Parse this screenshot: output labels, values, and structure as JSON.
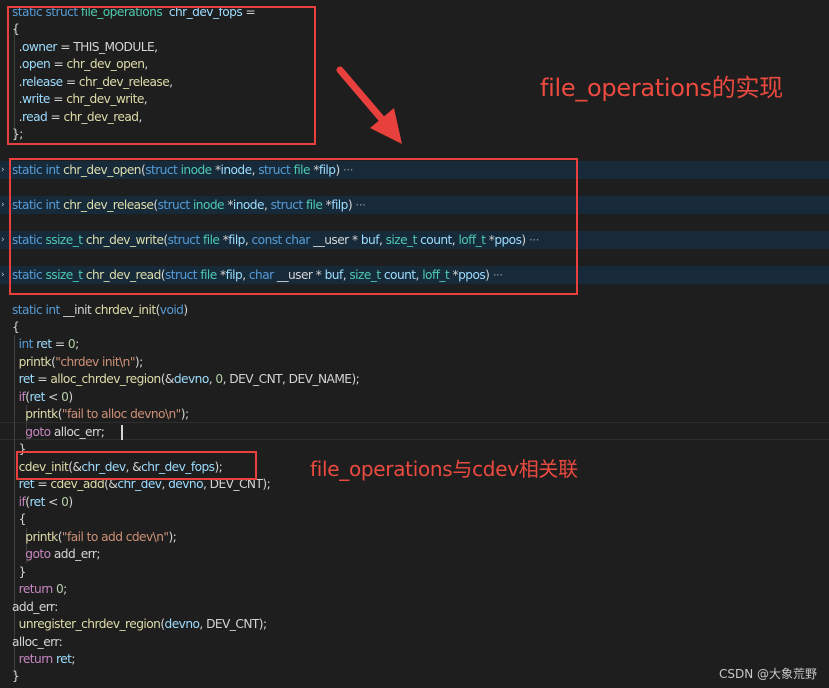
{
  "code": {
    "l01": [
      {
        "t": "static",
        "c": "kw"
      },
      {
        "t": " "
      },
      {
        "t": "struct",
        "c": "kw"
      },
      {
        "t": " "
      },
      {
        "t": "file_operations",
        "c": "ty"
      },
      {
        "t": "  "
      },
      {
        "t": "chr_dev_fops",
        "c": "var"
      },
      {
        "t": " ="
      }
    ],
    "l02": [
      {
        "t": "{"
      }
    ],
    "l03": [
      {
        "t": "  ."
      },
      {
        "t": "owner",
        "c": "var"
      },
      {
        "t": " = THIS_MODULE,"
      }
    ],
    "l04": [
      {
        "t": "  ."
      },
      {
        "t": "open",
        "c": "var"
      },
      {
        "t": " = "
      },
      {
        "t": "chr_dev_open",
        "c": "fn"
      },
      {
        "t": ","
      }
    ],
    "l05": [
      {
        "t": "  ."
      },
      {
        "t": "release",
        "c": "var"
      },
      {
        "t": " = "
      },
      {
        "t": "chr_dev_release",
        "c": "fn"
      },
      {
        "t": ","
      }
    ],
    "l06": [
      {
        "t": "  ."
      },
      {
        "t": "write",
        "c": "var"
      },
      {
        "t": " = "
      },
      {
        "t": "chr_dev_write",
        "c": "fn"
      },
      {
        "t": ","
      }
    ],
    "l07": [
      {
        "t": "  ."
      },
      {
        "t": "read",
        "c": "var"
      },
      {
        "t": " = "
      },
      {
        "t": "chr_dev_read",
        "c": "fn"
      },
      {
        "t": ","
      }
    ],
    "l08": [
      {
        "t": "};"
      }
    ],
    "l09": [
      {
        "t": "static",
        "c": "kw"
      },
      {
        "t": " "
      },
      {
        "t": "int",
        "c": "kw"
      },
      {
        "t": " "
      },
      {
        "t": "chr_dev_open",
        "c": "fn"
      },
      {
        "t": "("
      },
      {
        "t": "struct",
        "c": "kw"
      },
      {
        "t": " "
      },
      {
        "t": "inode",
        "c": "ty"
      },
      {
        "t": " *"
      },
      {
        "t": "inode",
        "c": "var"
      },
      {
        "t": ", "
      },
      {
        "t": "struct",
        "c": "kw"
      },
      {
        "t": " "
      },
      {
        "t": "file",
        "c": "ty"
      },
      {
        "t": " *"
      },
      {
        "t": "filp",
        "c": "var"
      },
      {
        "t": ")"
      },
      {
        "t": " ···",
        "c": "ell"
      }
    ],
    "l10": [
      {
        "t": "static",
        "c": "kw"
      },
      {
        "t": " "
      },
      {
        "t": "int",
        "c": "kw"
      },
      {
        "t": " "
      },
      {
        "t": "chr_dev_release",
        "c": "fn"
      },
      {
        "t": "("
      },
      {
        "t": "struct",
        "c": "kw"
      },
      {
        "t": " "
      },
      {
        "t": "inode",
        "c": "ty"
      },
      {
        "t": " *"
      },
      {
        "t": "inode",
        "c": "var"
      },
      {
        "t": ", "
      },
      {
        "t": "struct",
        "c": "kw"
      },
      {
        "t": " "
      },
      {
        "t": "file",
        "c": "ty"
      },
      {
        "t": " *"
      },
      {
        "t": "filp",
        "c": "var"
      },
      {
        "t": ")"
      },
      {
        "t": " ···",
        "c": "ell"
      }
    ],
    "l11": [
      {
        "t": "static",
        "c": "kw"
      },
      {
        "t": " "
      },
      {
        "t": "ssize_t",
        "c": "ty"
      },
      {
        "t": " "
      },
      {
        "t": "chr_dev_write",
        "c": "fn"
      },
      {
        "t": "("
      },
      {
        "t": "struct",
        "c": "kw"
      },
      {
        "t": " "
      },
      {
        "t": "file",
        "c": "ty"
      },
      {
        "t": " *"
      },
      {
        "t": "filp",
        "c": "var"
      },
      {
        "t": ", "
      },
      {
        "t": "const",
        "c": "kw"
      },
      {
        "t": " "
      },
      {
        "t": "char",
        "c": "kw"
      },
      {
        "t": " __user * "
      },
      {
        "t": "buf",
        "c": "var"
      },
      {
        "t": ", "
      },
      {
        "t": "size_t",
        "c": "ty"
      },
      {
        "t": " "
      },
      {
        "t": "count",
        "c": "var"
      },
      {
        "t": ", "
      },
      {
        "t": "loff_t",
        "c": "ty"
      },
      {
        "t": " *"
      },
      {
        "t": "ppos",
        "c": "var"
      },
      {
        "t": ")"
      },
      {
        "t": " ···",
        "c": "ell"
      }
    ],
    "l12": [
      {
        "t": "static",
        "c": "kw"
      },
      {
        "t": " "
      },
      {
        "t": "ssize_t",
        "c": "ty"
      },
      {
        "t": " "
      },
      {
        "t": "chr_dev_read",
        "c": "fn"
      },
      {
        "t": "("
      },
      {
        "t": "struct",
        "c": "kw"
      },
      {
        "t": " "
      },
      {
        "t": "file",
        "c": "ty"
      },
      {
        "t": " *"
      },
      {
        "t": "filp",
        "c": "var"
      },
      {
        "t": ", "
      },
      {
        "t": "char",
        "c": "kw"
      },
      {
        "t": " __user * "
      },
      {
        "t": "buf",
        "c": "var"
      },
      {
        "t": ", "
      },
      {
        "t": "size_t",
        "c": "ty"
      },
      {
        "t": " "
      },
      {
        "t": "count",
        "c": "var"
      },
      {
        "t": ", "
      },
      {
        "t": "loff_t",
        "c": "ty"
      },
      {
        "t": " *"
      },
      {
        "t": "ppos",
        "c": "var"
      },
      {
        "t": ")"
      },
      {
        "t": " ···",
        "c": "ell"
      }
    ],
    "l13": [
      {
        "t": "static",
        "c": "kw"
      },
      {
        "t": " "
      },
      {
        "t": "int",
        "c": "kw"
      },
      {
        "t": " __init "
      },
      {
        "t": "chrdev_init",
        "c": "fn"
      },
      {
        "t": "("
      },
      {
        "t": "void",
        "c": "kw"
      },
      {
        "t": ")"
      }
    ],
    "l14": [
      {
        "t": "{"
      }
    ],
    "l15": [
      {
        "t": "  "
      },
      {
        "t": "int",
        "c": "kw"
      },
      {
        "t": " "
      },
      {
        "t": "ret",
        "c": "var"
      },
      {
        "t": " = "
      },
      {
        "t": "0",
        "c": "num"
      },
      {
        "t": ";"
      }
    ],
    "l16": [
      {
        "t": "  "
      },
      {
        "t": "printk",
        "c": "fn"
      },
      {
        "t": "("
      },
      {
        "t": "\"chrdev init\\n\"",
        "c": "str"
      },
      {
        "t": ");"
      }
    ],
    "l17": [
      {
        "t": "  "
      },
      {
        "t": "ret",
        "c": "var"
      },
      {
        "t": " = "
      },
      {
        "t": "alloc_chrdev_region",
        "c": "fn"
      },
      {
        "t": "(&"
      },
      {
        "t": "devno",
        "c": "var"
      },
      {
        "t": ", "
      },
      {
        "t": "0",
        "c": "num"
      },
      {
        "t": ", DEV_CNT, DEV_NAME);"
      }
    ],
    "l18": [
      {
        "t": "  "
      },
      {
        "t": "if",
        "c": "ctl"
      },
      {
        "t": "("
      },
      {
        "t": "ret",
        "c": "var"
      },
      {
        "t": " < "
      },
      {
        "t": "0",
        "c": "num"
      },
      {
        "t": ")"
      }
    ],
    "l19": [
      {
        "t": "    "
      },
      {
        "t": "printk",
        "c": "fn"
      },
      {
        "t": "("
      },
      {
        "t": "\"fail to alloc devno\\n\"",
        "c": "str"
      },
      {
        "t": ");"
      }
    ],
    "l20": [
      {
        "t": "    "
      },
      {
        "t": "goto",
        "c": "ctl"
      },
      {
        "t": " alloc_err;"
      }
    ],
    "l21": [
      {
        "t": "  }"
      }
    ],
    "l22": [
      {
        "t": "  "
      },
      {
        "t": "cdev_init",
        "c": "fn"
      },
      {
        "t": "(&"
      },
      {
        "t": "chr_dev",
        "c": "var"
      },
      {
        "t": ", &"
      },
      {
        "t": "chr_dev_fops",
        "c": "var"
      },
      {
        "t": ");"
      }
    ],
    "l23": [
      {
        "t": "  "
      },
      {
        "t": "ret",
        "c": "var"
      },
      {
        "t": " = "
      },
      {
        "t": "cdev_add",
        "c": "fn"
      },
      {
        "t": "(&"
      },
      {
        "t": "chr_dev",
        "c": "var"
      },
      {
        "t": ", "
      },
      {
        "t": "devno",
        "c": "var"
      },
      {
        "t": ", DEV_CNT);"
      }
    ],
    "l24": [
      {
        "t": "  "
      },
      {
        "t": "if",
        "c": "ctl"
      },
      {
        "t": "("
      },
      {
        "t": "ret",
        "c": "var"
      },
      {
        "t": " < "
      },
      {
        "t": "0",
        "c": "num"
      },
      {
        "t": ")"
      }
    ],
    "l25": [
      {
        "t": "  {"
      }
    ],
    "l26": [
      {
        "t": "    "
      },
      {
        "t": "printk",
        "c": "fn"
      },
      {
        "t": "("
      },
      {
        "t": "\"fail to add cdev\\n\"",
        "c": "str"
      },
      {
        "t": ");"
      }
    ],
    "l27": [
      {
        "t": "    "
      },
      {
        "t": "goto",
        "c": "ctl"
      },
      {
        "t": " add_err;"
      }
    ],
    "l28": [
      {
        "t": "  }"
      }
    ],
    "l29": [
      {
        "t": "  "
      },
      {
        "t": "return",
        "c": "ctl"
      },
      {
        "t": " "
      },
      {
        "t": "0",
        "c": "num"
      },
      {
        "t": ";"
      }
    ],
    "l30": [
      {
        "t": "add_err:"
      }
    ],
    "l31": [
      {
        "t": "  "
      },
      {
        "t": "unregister_chrdev_region",
        "c": "fn"
      },
      {
        "t": "("
      },
      {
        "t": "devno",
        "c": "var"
      },
      {
        "t": ", DEV_CNT);"
      }
    ],
    "l32": [
      {
        "t": "alloc_err:"
      }
    ],
    "l33": [
      {
        "t": "  "
      },
      {
        "t": "return",
        "c": "ctl"
      },
      {
        "t": " "
      },
      {
        "t": "ret",
        "c": "var"
      },
      {
        "t": ";"
      }
    ],
    "l34": [
      {
        "t": "}"
      }
    ]
  },
  "annotations": {
    "fops_note": "file_operations的实现",
    "link_note": "file_operations与cdev相关联"
  },
  "watermark": "CSDN @大象荒野",
  "colors": {
    "background": "#1e1e1e",
    "annotation_red": "#e8403c",
    "keyword": "#569cd6",
    "function": "#dcdcaa",
    "variable": "#9cdcfe",
    "type": "#4ec9b0",
    "string": "#ce9178",
    "number": "#b5cea8",
    "control": "#c586c0",
    "fold_band": "#172a3a"
  },
  "icons": {
    "fold": "chevron-right-icon",
    "arrow": "red-arrow-icon"
  }
}
